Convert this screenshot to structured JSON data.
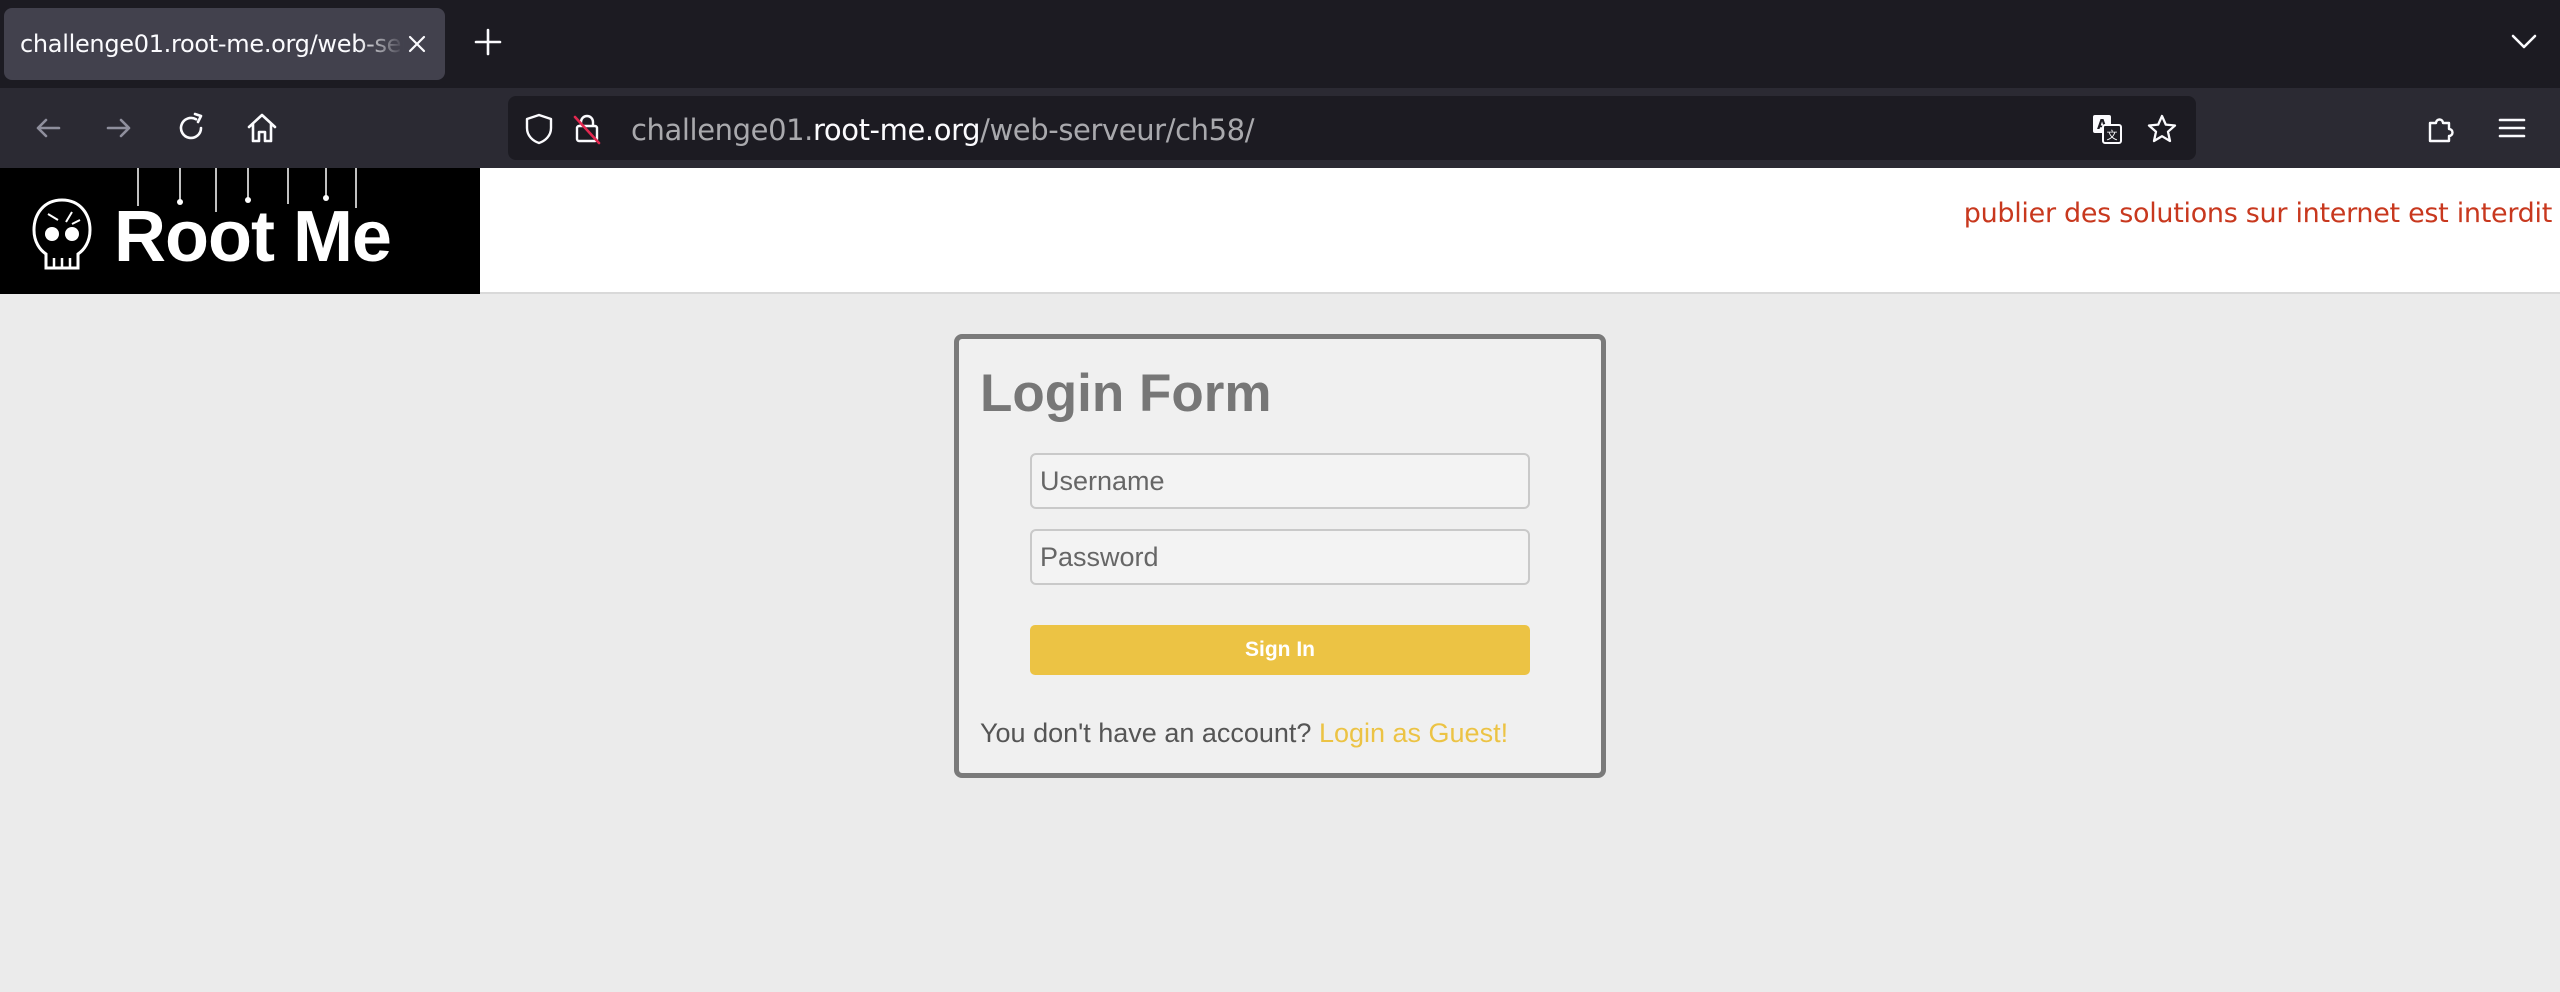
{
  "browser": {
    "tab_title": "challenge01.root-me.org/web-serveur/ch58/",
    "url": {
      "prefix": "challenge01.",
      "domain": "root-me.org",
      "path": "/web-serveur/ch58/"
    },
    "icons": [
      "close-icon",
      "plus-icon",
      "chevron-down-icon",
      "back-arrow-icon",
      "forward-arrow-icon",
      "reload-icon",
      "home-icon",
      "shield-icon",
      "insecure-lock-icon",
      "translate-icon",
      "star-icon",
      "extensions-icon",
      "menu-icon"
    ]
  },
  "header": {
    "logo_text": "Root Me",
    "notice": "publier des solutions sur internet est interdit",
    "notice_color": "#c8381e"
  },
  "login": {
    "title": "Login Form",
    "username_placeholder": "Username",
    "password_placeholder": "Password",
    "signin_label": "Sign In",
    "no_account_text": "You don't have an account?",
    "guest_link": "Login as Guest!",
    "accent_color": "#ecc344"
  }
}
